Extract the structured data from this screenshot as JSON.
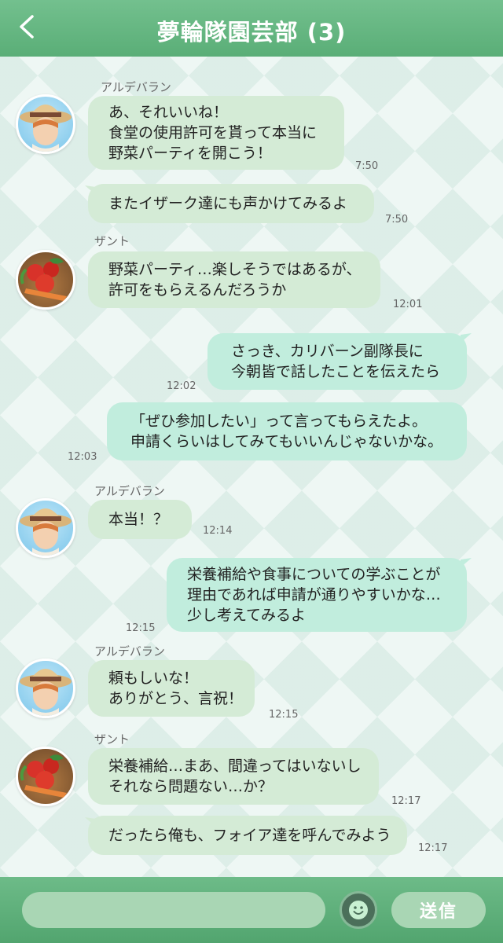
{
  "header": {
    "back_icon": "chevron-left-icon",
    "title": "夢輪隊園芸部 (3)"
  },
  "messages": [
    {
      "sender": "アルデバラン",
      "lines": [
        "あ、それいいね！",
        "食堂の使用許可を貰って本当に",
        "野菜パーティを開こう！"
      ],
      "time": "7:50"
    },
    {
      "lines": [
        "またイザーク達にも声かけてみるよ"
      ],
      "time": "7:50"
    },
    {
      "sender": "ザント",
      "lines": [
        "野菜パーティ…楽しそうではあるが、",
        "許可をもらえるんだろうか"
      ],
      "time": "12:01"
    },
    {
      "lines": [
        "さっき、カリバーン副隊長に",
        "今朝皆で話したことを伝えたら"
      ],
      "time": "12:02"
    },
    {
      "lines": [
        "「ぜひ参加したい」って言ってもらえたよ。",
        "申請くらいはしてみてもいいんじゃないかな。"
      ],
      "time": "12:03"
    },
    {
      "sender": "アルデバラン",
      "lines": [
        "本当！？"
      ],
      "time": "12:14"
    },
    {
      "lines": [
        "栄養補給や食事についての学ぶことが",
        "理由であれば申請が通りやすいかな…",
        "少し考えてみるよ"
      ],
      "time": "12:15"
    },
    {
      "sender": "アルデバラン",
      "lines": [
        "頼もしいな！",
        "ありがとう、言祝！"
      ],
      "time": "12:15"
    },
    {
      "sender": "ザント",
      "lines": [
        "栄養補給…まあ、間違ってはいないし",
        "それなら問題ない…か？"
      ],
      "time": "12:17"
    },
    {
      "lines": [
        "だったら俺も、フォイア達を呼んでみよう"
      ],
      "time": "12:17"
    }
  ],
  "footer": {
    "input_placeholder": "",
    "emoji_icon": "smile-icon",
    "send_label": "送信"
  },
  "colors": {
    "header": "#5fb37b",
    "incoming_bubble": "#d4ebd6",
    "outgoing_bubble": "#c1eddd",
    "footer": "#5aa974"
  }
}
